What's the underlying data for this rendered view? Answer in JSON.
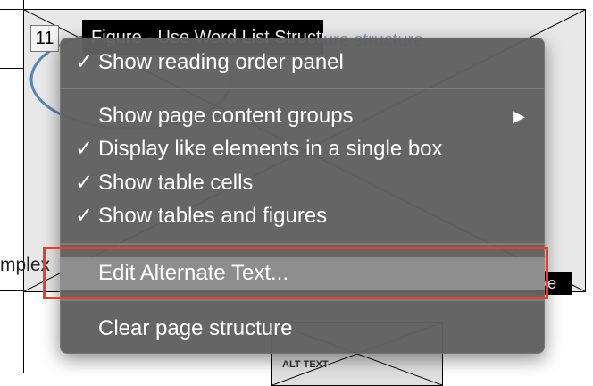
{
  "background": {
    "tag_number": "11",
    "figure_tag": "Figure - Use Word List Structure",
    "figure_tag_tail": "ure structure",
    "side_text": "mplex",
    "black_tab": "ive",
    "bottom_label": "ALT TEXT"
  },
  "menu": {
    "items": [
      {
        "label": "Show reading order panel",
        "check": "✓"
      },
      {
        "label": "Show page content groups",
        "check": "",
        "submenu_arrow": "▶"
      },
      {
        "label": "Display like elements in a single box",
        "check": "✓"
      },
      {
        "label": "Show table cells",
        "check": "✓"
      },
      {
        "label": "Show tables and figures",
        "check": "✓"
      },
      {
        "label": "Edit Alternate Text...",
        "check": ""
      },
      {
        "label": "Clear page structure",
        "check": ""
      }
    ]
  },
  "colors": {
    "menu_bg": "#606060",
    "highlight": "#8d8d8d",
    "callout": "#e5402e"
  }
}
